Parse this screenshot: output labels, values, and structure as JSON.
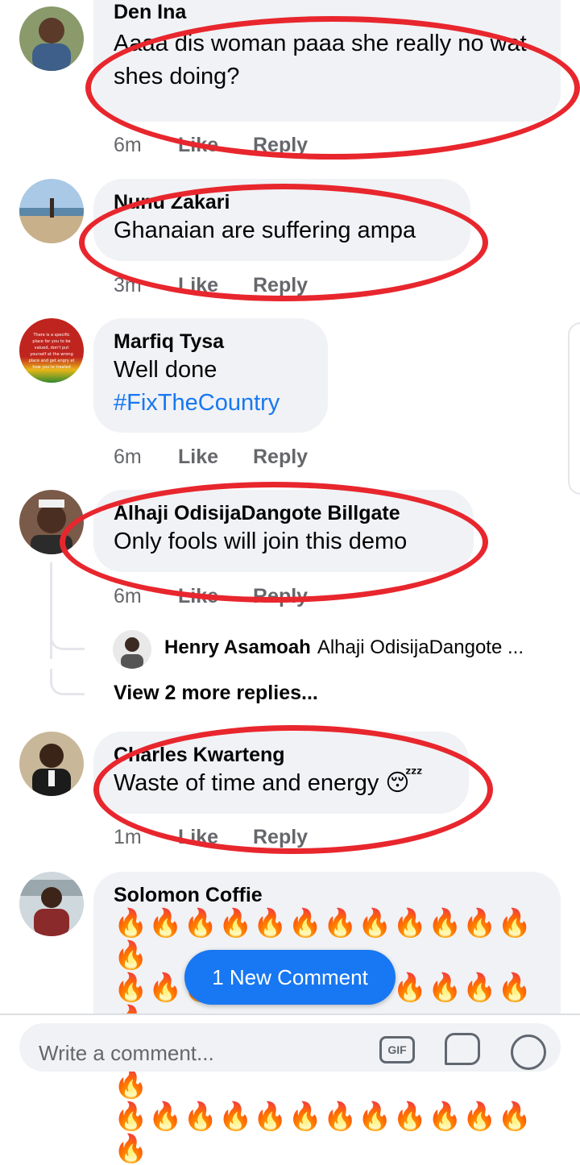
{
  "colors": {
    "bubble": "#f0f2f5",
    "accent_blue": "#1877f2",
    "annotation_red": "#e8262d",
    "meta_gray": "#65676b"
  },
  "comments": [
    {
      "author": "Den Ina",
      "text": "Aaaa dis woman paaa she really no wat shes doing?",
      "time": "6m",
      "like": "Like",
      "reply": "Reply"
    },
    {
      "author": "Nunu Zakari",
      "text": "Ghanaian are suffering ampa",
      "time": "3m",
      "like": "Like",
      "reply": "Reply"
    },
    {
      "author": "Marfiq Tysa",
      "text": "Well done",
      "hashtag": "#FixTheCountry",
      "time": "6m",
      "like": "Like",
      "reply": "Reply"
    },
    {
      "author": "Alhaji OdisijaDangote Billgate",
      "text": "Only fools will join this demo",
      "time": "6m",
      "like": "Like",
      "reply": "Reply",
      "reply_preview": {
        "author": "Henry Asamoah",
        "text": "Alhaji OdisijaDangote ..."
      },
      "view_more": "View 2 more replies..."
    },
    {
      "author": "Charles Kwarteng",
      "text": "Waste of time and energy 😴",
      "time": "1m",
      "like": "Like",
      "reply": "Reply"
    },
    {
      "author": "Solomon Coffie",
      "text_rows": [
        "🔥🔥🔥🔥🔥🔥🔥🔥🔥🔥🔥🔥🔥",
        "🔥🔥🔥🔥🔥🔥🔥🔥🔥🔥🔥🔥🔥",
        "🔥🔥🔥🔥🔥🔥🔥🔥🔥🔥🔥🔥🔥",
        "🔥🔥🔥🔥🔥🔥🔥🔥🔥🔥🔥🔥🔥"
      ]
    }
  ],
  "avatar_quote": [
    "There is a specific",
    "place for you to be",
    "valued, don't put",
    "yourself at the wrong",
    "place and get angry at",
    "how you're treated"
  ],
  "new_comment_pill": "1 New Comment",
  "composer": {
    "placeholder": "Write a comment...",
    "gif_label": "GIF"
  }
}
